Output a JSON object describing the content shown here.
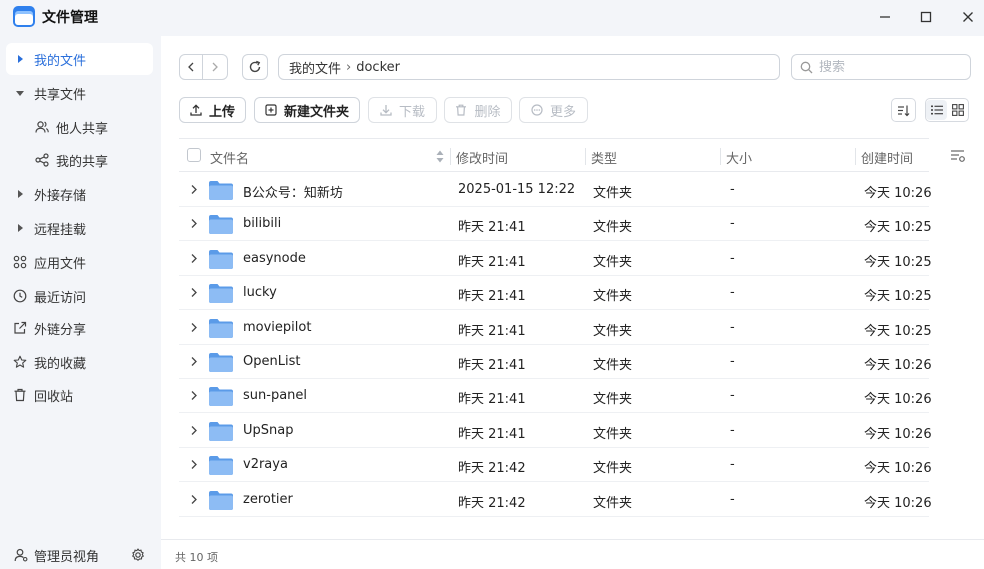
{
  "window": {
    "title": "文件管理"
  },
  "sidebar": {
    "items": [
      {
        "label": "我的文件",
        "icon": "caret-right-icon"
      },
      {
        "label": "共享文件",
        "icon": "caret-down-icon"
      },
      {
        "label": "他人共享",
        "icon": "users-icon"
      },
      {
        "label": "我的共享",
        "icon": "share-icon"
      },
      {
        "label": "外接存储",
        "icon": "caret-right-icon"
      },
      {
        "label": "远程挂载",
        "icon": "caret-right-icon"
      },
      {
        "label": "应用文件",
        "icon": "apps-icon"
      },
      {
        "label": "最近访问",
        "icon": "clock-icon"
      },
      {
        "label": "外链分享",
        "icon": "external-share-icon"
      },
      {
        "label": "我的收藏",
        "icon": "star-icon"
      },
      {
        "label": "回收站",
        "icon": "trash-icon"
      }
    ],
    "footer": {
      "label": "管理员视角"
    }
  },
  "path": {
    "root": "我的文件",
    "sep": "›",
    "current": "docker"
  },
  "search": {
    "placeholder": "搜索"
  },
  "toolbar": {
    "upload": "上传",
    "new_folder": "新建文件夹",
    "download": "下载",
    "delete": "删除",
    "more": "更多"
  },
  "table": {
    "columns": {
      "name": "文件名",
      "modified": "修改时间",
      "type": "类型",
      "size": "大小",
      "created": "创建时间"
    },
    "rows": [
      {
        "name": "B公众号：知新坊",
        "modified": "2025-01-15 12:22",
        "type": "文件夹",
        "size": "-",
        "created": "今天 10:26"
      },
      {
        "name": "bilibili",
        "modified": "昨天 21:41",
        "type": "文件夹",
        "size": "-",
        "created": "今天 10:25"
      },
      {
        "name": "easynode",
        "modified": "昨天 21:41",
        "type": "文件夹",
        "size": "-",
        "created": "今天 10:25"
      },
      {
        "name": "lucky",
        "modified": "昨天 21:41",
        "type": "文件夹",
        "size": "-",
        "created": "今天 10:25"
      },
      {
        "name": "moviepilot",
        "modified": "昨天 21:41",
        "type": "文件夹",
        "size": "-",
        "created": "今天 10:25"
      },
      {
        "name": "OpenList",
        "modified": "昨天 21:41",
        "type": "文件夹",
        "size": "-",
        "created": "今天 10:26"
      },
      {
        "name": "sun-panel",
        "modified": "昨天 21:41",
        "type": "文件夹",
        "size": "-",
        "created": "今天 10:26"
      },
      {
        "name": "UpSnap",
        "modified": "昨天 21:41",
        "type": "文件夹",
        "size": "-",
        "created": "今天 10:26"
      },
      {
        "name": "v2raya",
        "modified": "昨天 21:42",
        "type": "文件夹",
        "size": "-",
        "created": "今天 10:26"
      },
      {
        "name": "zerotier",
        "modified": "昨天 21:42",
        "type": "文件夹",
        "size": "-",
        "created": "今天 10:26"
      }
    ]
  },
  "status": {
    "count": "共 10 项"
  },
  "colors": {
    "accent": "#2a6fdb",
    "folder": "#6aa8ee",
    "sidebar_bg": "#f3f5f9"
  }
}
